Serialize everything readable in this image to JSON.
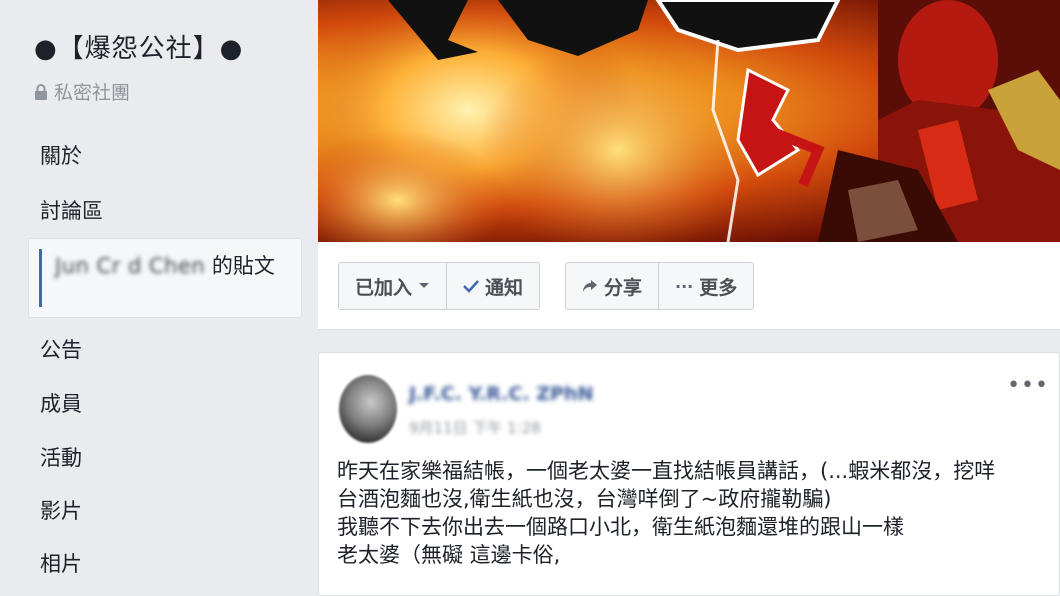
{
  "sidebar": {
    "group_name": "●【爆怨公社】●",
    "privacy_label": "私密社團",
    "nav": {
      "about": "關於",
      "discussion": "討論區",
      "user_posts_name": "Jun Cr d Chen",
      "user_posts_suffix": "的貼文",
      "announcements": "公告",
      "members": "成員",
      "events": "活動",
      "videos": "影片",
      "photos": "相片"
    }
  },
  "actions": {
    "joined": "已加入",
    "notifications": "通知",
    "share": "分享",
    "more": "更多"
  },
  "post": {
    "author": "J.F.C. Y.R.C. ZPhN",
    "timestamp": "9月11日 下午 1:28",
    "more_icon": "•••",
    "lines": [
      "昨天在家樂福結帳，一個老太婆一直找結帳員講話，(...蝦米都沒，挖咩",
      "台酒泡麵也沒,衛生紙也沒，台灣咩倒了~政府攏勒騙)",
      "我聽不下去你出去一個路口小北，衛生紙泡麵還堆的跟山一樣",
      "老太婆（無礙 這邊卡俗,"
    ]
  },
  "icons": {
    "lock": "lock-icon",
    "caret": "caret-down-icon",
    "check": "check-icon",
    "share": "share-arrow-icon",
    "more": "ellipsis-icon"
  },
  "colors": {
    "link": "#385898",
    "background": "#e9ebee",
    "active_bar": "#4267b2"
  }
}
